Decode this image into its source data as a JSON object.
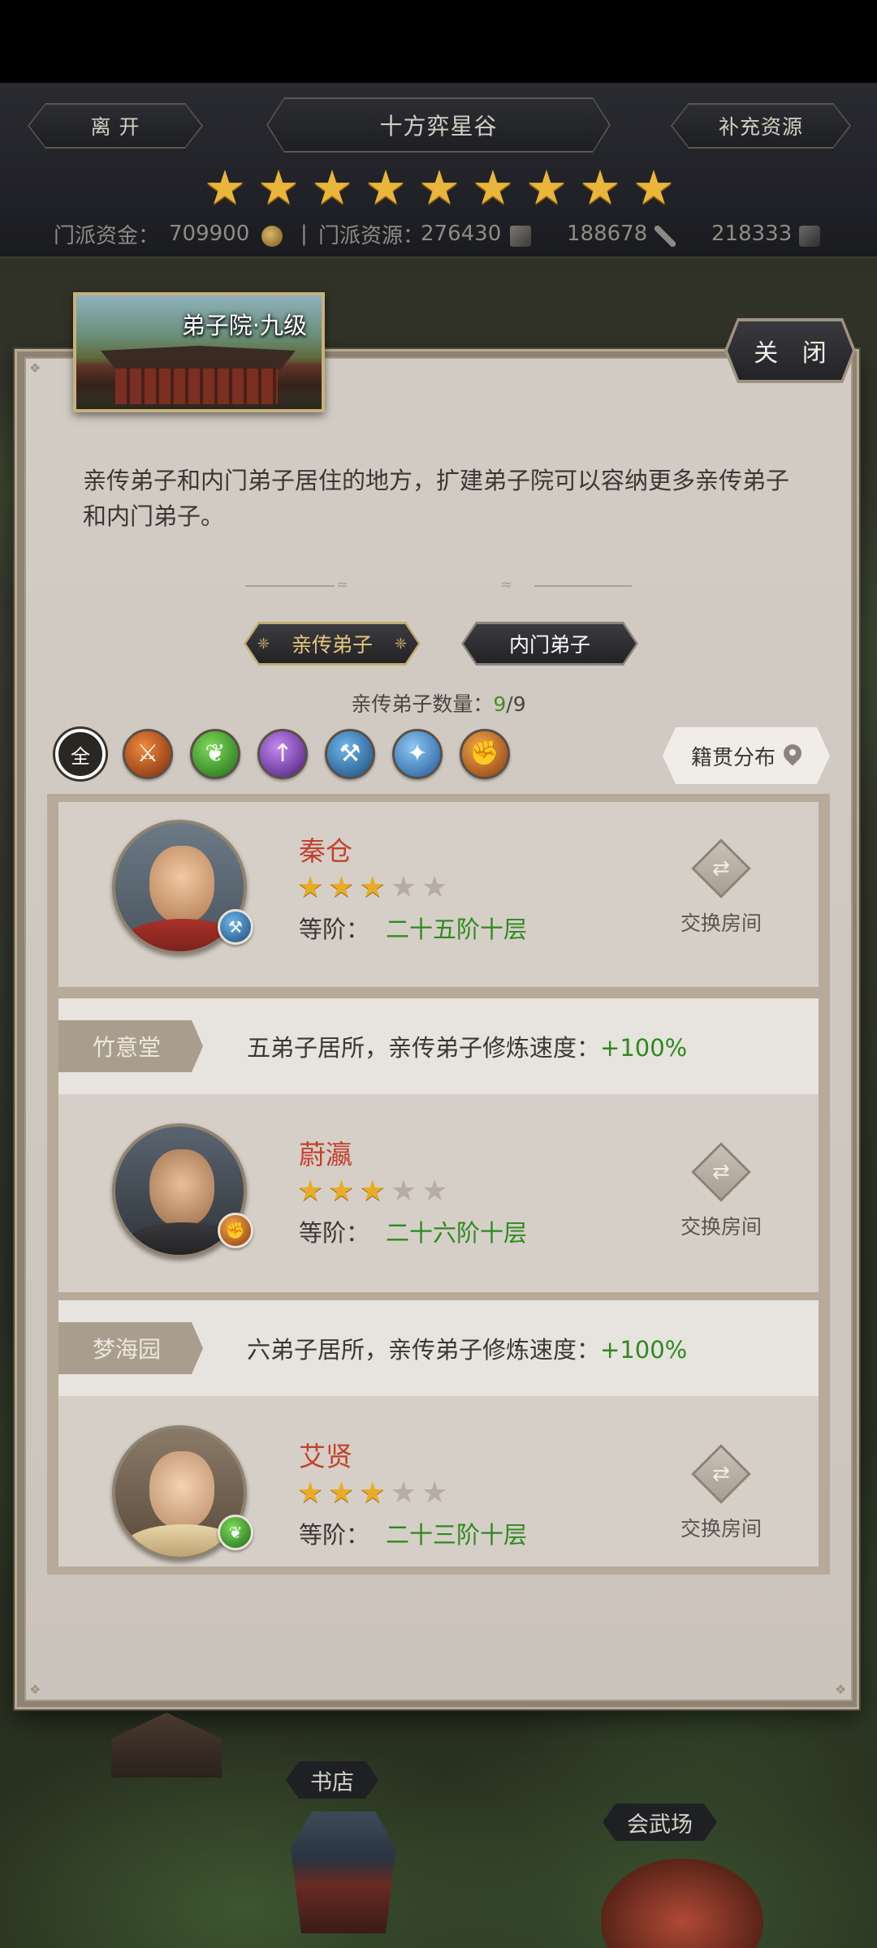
{
  "header": {
    "leave_label": "离 开",
    "location_title": "十方弈星谷",
    "replenish_label": "补充资源",
    "star_count": 9,
    "funds_label": "门派资金：",
    "funds_value": "709900",
    "separator": "|",
    "resources_label": "门派资源：",
    "resource_1": "276430",
    "resource_2": "188678",
    "resource_3": "218333"
  },
  "panel": {
    "building_title": "弟子院·九级",
    "close_label": "关 闭",
    "description": "亲传弟子和内门弟子居住的地方，扩建弟子院可以容纳更多亲传弟子和内门弟子。",
    "tabs": [
      {
        "label": "亲传弟子",
        "active": true
      },
      {
        "label": "内门弟子",
        "active": false
      }
    ],
    "count_label": "亲传弟子数量：",
    "count_current": "9",
    "count_sep": "/",
    "count_max": "9",
    "filter_all_label": "全",
    "filters": [
      "all",
      "sword",
      "leaf",
      "spear",
      "hammer",
      "blade",
      "fist"
    ],
    "origin_label": "籍贯分布"
  },
  "disciples": [
    {
      "name": "秦仓",
      "stars": 3,
      "max_stars": 5,
      "rank_label": "等阶：",
      "rank_value": "二十五阶十层",
      "swap_label": "交换房间",
      "badge": "hammer"
    },
    {
      "name": "蔚瀛",
      "stars": 3,
      "max_stars": 5,
      "rank_label": "等阶：",
      "rank_value": "二十六阶十层",
      "swap_label": "交换房间",
      "badge": "fist"
    },
    {
      "name": "艾贤",
      "stars": 3,
      "max_stars": 5,
      "rank_label": "等阶：",
      "rank_value": "二十三阶十层",
      "swap_label": "交换房间",
      "badge": "leaf"
    }
  ],
  "rooms": [
    {
      "tag": "竹意堂",
      "text": "五弟子居所，亲传弟子修炼速度：",
      "bonus": "+100%"
    },
    {
      "tag": "梦海园",
      "text": "六弟子居所，亲传弟子修炼速度：",
      "bonus": "+100%"
    }
  ],
  "map": {
    "bookstore_label": "书店",
    "arena_label": "会武场"
  },
  "colors": {
    "name_red": "#c2422c",
    "value_green": "#2e8a1e",
    "star_gold": "#e8ad28",
    "active_tab_gold": "#e8c77e"
  }
}
